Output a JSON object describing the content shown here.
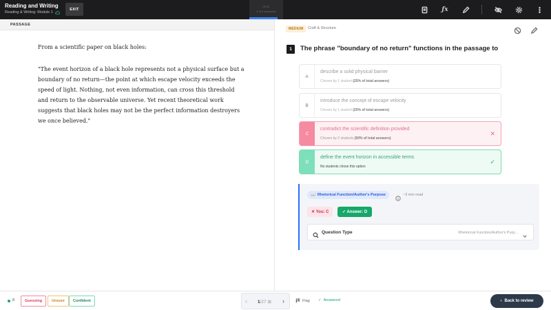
{
  "topbar": {
    "title": "Reading and Writing",
    "subtitle": "Reading & Writing: Module 1",
    "exit_label": "EXIT",
    "timer_label": "00:00",
    "answered_label": "0 of 6 answered",
    "progress_fraction": 0.83,
    "icons": [
      "notes-icon",
      "formula-icon",
      "pen-icon",
      "hide-icon",
      "settings-icon",
      "more-icon"
    ]
  },
  "passage": {
    "header": "PASSAGE",
    "intro": "From a scientific paper on black holes:",
    "body": "\"The event horizon of a black hole represents not a physical surface but a boundary of no return—the point at which escape velocity exceeds the speed of light. Nothing, not even information, can cross this threshold and return to the observable universe. Yet recent theoretical work suggests that black holes may not be the perfect information destroyers we once believed.\""
  },
  "question": {
    "difficulty": "MEDIUM",
    "skill": "Craft & Structure",
    "number": "1",
    "text": "The phrase \"boundary of no return\" functions in the passage to",
    "choices": [
      {
        "letter": "A",
        "text": "describe a solid physical barrier",
        "stat_prefix": "Chosen by 1 student",
        "stat_pct": "(25% of total answers)",
        "state": "neutral"
      },
      {
        "letter": "B",
        "text": "introduce the concept of escape velocity",
        "stat_prefix": "Chosen by 1 student",
        "stat_pct": "(25% of total answers)",
        "state": "neutral"
      },
      {
        "letter": "C",
        "text": "contradict the scientific definition provided",
        "stat_prefix": "Chosen by 2 students",
        "stat_pct": "(50% of total answers)",
        "state": "wrong"
      },
      {
        "letter": "D",
        "text": "define the event horizon in accessible terms",
        "stat_prefix": "No students chose this option",
        "stat_pct": "",
        "state": "correct"
      }
    ]
  },
  "explanation": {
    "tag": "Rhetorical Function/Author's Purpose",
    "read_time": "~3 min read",
    "you_label": "You: C",
    "answer_label": "Answer: D",
    "qtype_label": "Question Type",
    "qtype_value": "Rhetorical Function/Author's Purp..."
  },
  "bottombar": {
    "count": "8",
    "guessing": "Guessing",
    "unsure": "Unsure",
    "confident": "Confident",
    "page_current": "1",
    "page_total": "/27",
    "flag_label": "Flag",
    "answered_label": "Answered",
    "back_label": "Back to review"
  },
  "colors": {
    "topbar_bg": "#1c1c1e",
    "accent": "#2b6cff",
    "correct": "#16a86a",
    "wrong": "#f58aa0"
  }
}
